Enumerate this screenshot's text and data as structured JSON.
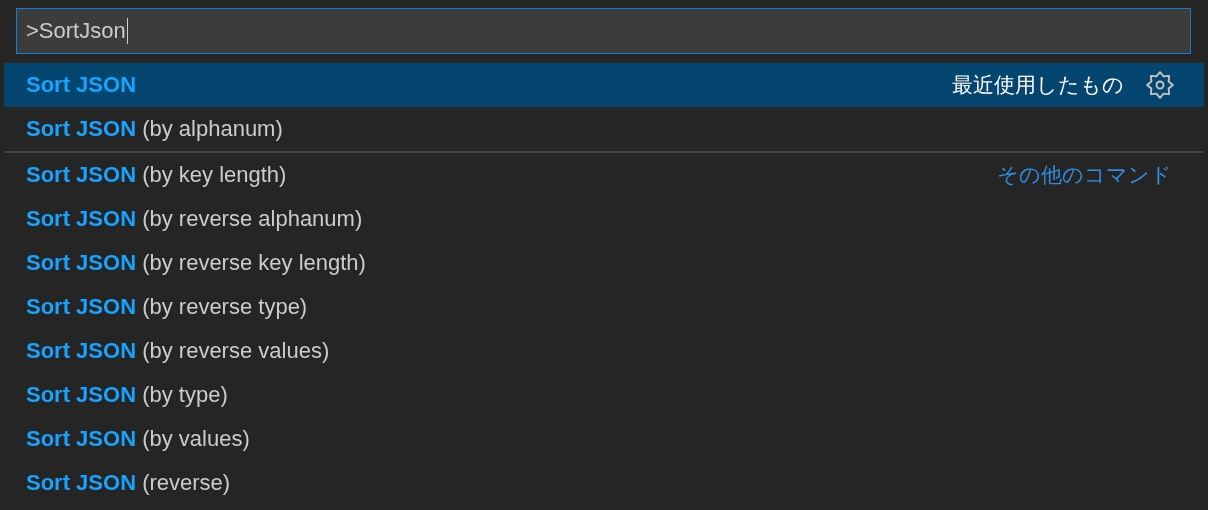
{
  "command_input": {
    "value": ">SortJson"
  },
  "items": [
    {
      "label": "**Sort JSON**",
      "selected": true,
      "separator_above": false,
      "group": "最近使用したもの",
      "settings": true
    },
    {
      "label": "**Sort JSON** (by alphanum)",
      "selected": false,
      "separator_above": false
    },
    {
      "label": "**Sort JSON** (by key length)",
      "selected": false,
      "separator_above": true,
      "group": "その他のコマンド"
    },
    {
      "label": "**Sort JSON** (by reverse alphanum)",
      "selected": false,
      "separator_above": false
    },
    {
      "label": "**Sort JSON** (by reverse key length)",
      "selected": false,
      "separator_above": false
    },
    {
      "label": "**Sort JSON** (by reverse type)",
      "selected": false,
      "separator_above": false
    },
    {
      "label": "**Sort JSON** (by reverse values)",
      "selected": false,
      "separator_above": false
    },
    {
      "label": "**Sort JSON** (by type)",
      "selected": false,
      "separator_above": false
    },
    {
      "label": "**Sort JSON** (by values)",
      "selected": false,
      "separator_above": false
    },
    {
      "label": "**Sort JSON** (reverse)",
      "selected": false,
      "separator_above": false
    }
  ]
}
